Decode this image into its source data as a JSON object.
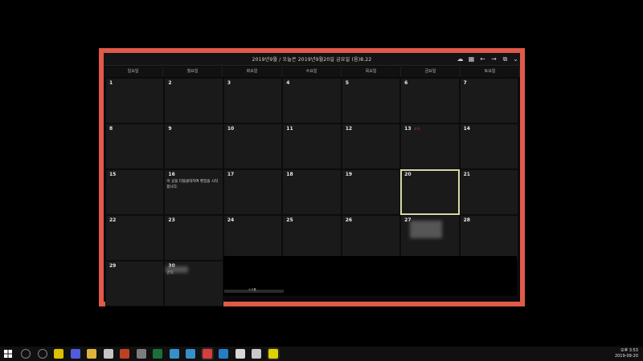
{
  "window": {
    "title": "2019년9월 / 오늘은 2019년9월20일 금요일 (음)8.22",
    "toolbar_icons": [
      "cloud-icon",
      "calendar-icon",
      "arrow-left-icon",
      "arrow-right-icon",
      "copy-icon",
      "chevron-down-icon"
    ]
  },
  "weekdays": [
    "일요일",
    "월요일",
    "화요일",
    "수요일",
    "목요일",
    "금요일",
    "토요일"
  ],
  "days": [
    {
      "n": "1"
    },
    {
      "n": "2"
    },
    {
      "n": "3"
    },
    {
      "n": "4"
    },
    {
      "n": "5"
    },
    {
      "n": "6"
    },
    {
      "n": "7"
    },
    {
      "n": "8"
    },
    {
      "n": "9"
    },
    {
      "n": "10"
    },
    {
      "n": "11"
    },
    {
      "n": "12"
    },
    {
      "n": "13",
      "holiday": "추석"
    },
    {
      "n": "14"
    },
    {
      "n": "15"
    },
    {
      "n": "16",
      "note": "이 곳을 더블클릭하여 편집을 시작합니다."
    },
    {
      "n": "17"
    },
    {
      "n": "18"
    },
    {
      "n": "19"
    },
    {
      "n": "20"
    },
    {
      "n": "21"
    },
    {
      "n": "22"
    },
    {
      "n": "23"
    },
    {
      "n": "24"
    },
    {
      "n": "25"
    },
    {
      "n": "26"
    },
    {
      "n": "27"
    },
    {
      "n": "28"
    },
    {
      "n": "29"
    },
    {
      "n": "30",
      "note": "면적"
    }
  ],
  "today": "20",
  "scroll_hint": "스크롤",
  "taskbar": {
    "clock_time": "오후 3:53",
    "clock_date": "2019-09-20",
    "apps": [
      "search-icon",
      "task-view-icon",
      "sticky-notes-icon",
      "app-icon",
      "file-explorer-icon",
      "paint-icon",
      "powerpoint-icon",
      "calculator-icon",
      "excel-icon",
      "ie-icon",
      "edge-icon",
      "chrome-icon",
      "photos-icon",
      "messenger-icon",
      "tool-icon",
      "kakaotalk-icon"
    ]
  },
  "colors": {
    "frame": "#e05a4a",
    "cell": "#1a1a1a",
    "holiday": "#c63a32",
    "today_outline": "#d9d7a8"
  }
}
